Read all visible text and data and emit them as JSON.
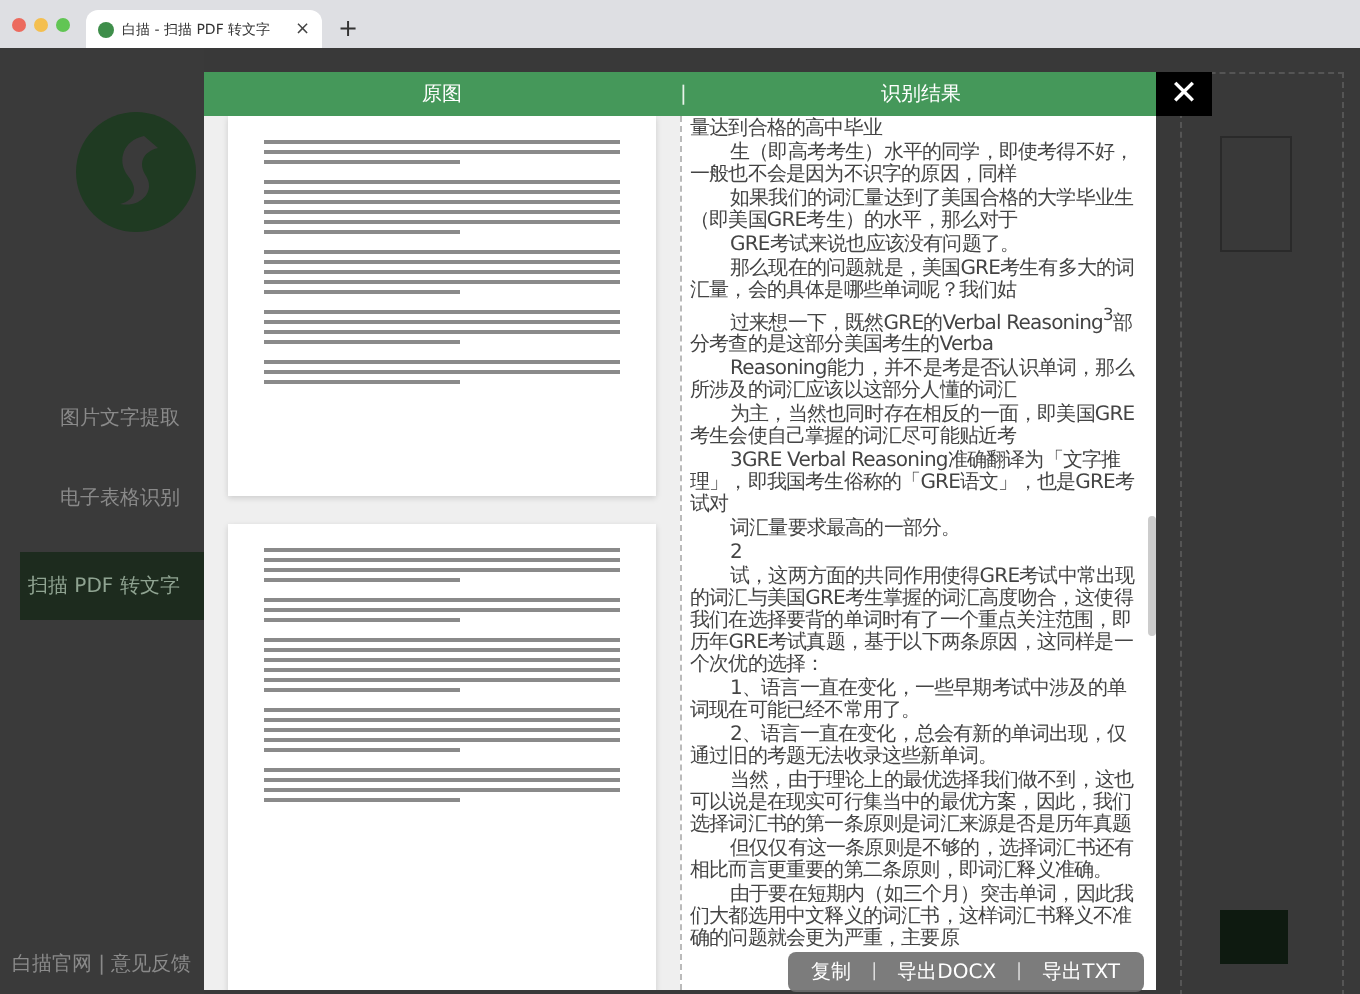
{
  "browser": {
    "tab_title": "白描 - 扫描 PDF 转文字",
    "tab_close": "×",
    "new_tab": "+"
  },
  "sidebar": {
    "items": [
      {
        "label": "图片文字提取",
        "selected": false
      },
      {
        "label": "电子表格识别",
        "selected": false
      },
      {
        "label": "扫描 PDF 转文字",
        "selected": true
      }
    ],
    "footer": "白描官网 | 意见反馈"
  },
  "modal": {
    "header_left": "原图",
    "header_divider": "|",
    "header_right": "识别结果",
    "close": "✕",
    "result_paragraphs": [
      {
        "text": "量达到合格的高中毕业",
        "indent": false
      },
      {
        "text": "生（即高考考生）水平的同学，即使考得不好，一般也不会是因为不识字的原因，同样",
        "indent": true
      },
      {
        "text": "如果我们的词汇量达到了美国合格的大学毕业生（即美国GRE考生）的水平，那么对于",
        "indent": true
      },
      {
        "text": "GRE考试来说也应该没有问题了。",
        "indent": true
      },
      {
        "text": "那么现在的问题就是，美国GRE考生有多大的词汇量，会的具体是哪些单词呢？我们姑",
        "indent": true
      },
      {
        "text": "过来想一下，既然GRE的Verbal Reasoning$^{3}$部分考查的是这部分美国考生的Verba",
        "indent": true
      },
      {
        "text": "Reasoning能力，并不是考是否认识单词，那么所涉及的词汇应该以这部分人懂的词汇",
        "indent": true
      },
      {
        "text": "为主，当然也同时存在相反的一面，即美国GRE考生会使自己掌握的词汇尽可能贴近考",
        "indent": true
      },
      {
        "text": "3GRE Verbal Reasoning准确翻译为「文字推理」，即我国考生俗称的「GRE语文」，也是GRE考试对",
        "indent": true
      },
      {
        "text": "词汇量要求最高的一部分。",
        "indent": true
      },
      {
        "text": "2",
        "indent": true
      },
      {
        "text": "试，这两方面的共同作用使得GRE考试中常出现的词汇与美国GRE考生掌握的词汇高度吻合，这使得我们在选择要背的单词时有了一个重点关注范围，即历年GRE考试真题，基于以下两条原因，这同样是一个次优的选择：",
        "indent": true
      },
      {
        "text": "1、语言一直在变化，一些早期考试中涉及的单词现在可能已经不常用了。",
        "indent": true
      },
      {
        "text": "2、语言一直在变化，总会有新的单词出现，仅通过旧的考题无法收录这些新单词。",
        "indent": true
      },
      {
        "text": "当然，由于理论上的最优选择我们做不到，这也可以说是在现实可行集当中的最优方案，因此，我们选择词汇书的第一条原则是词汇来源是否是历年真题",
        "indent": true
      },
      {
        "text": "但仅仅有这一条原则是不够的，选择词汇书还有相比而言更重要的第二条原则，即词汇释义准确。",
        "indent": true
      },
      {
        "text": "由于要在短期内（如三个月）突击单词，因此我们大都选用中文释义的词汇书，这样词汇书释义不准确的问题就会更为严重，主要原",
        "indent": true
      }
    ],
    "actions": [
      {
        "label": "复制"
      },
      {
        "label": "导出DOCX"
      },
      {
        "label": "导出TXT"
      }
    ],
    "action_divider": "|"
  }
}
